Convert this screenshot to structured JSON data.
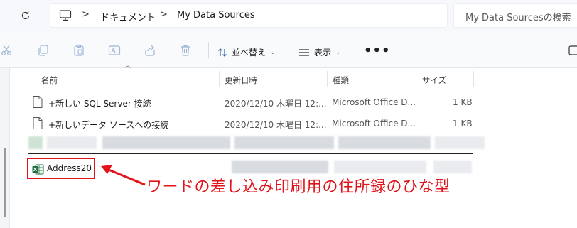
{
  "address_bar": {
    "crumbs": [
      "ドキュメント",
      "My Data Sources"
    ],
    "search_placeholder": "My Data Sourcesの検索"
  },
  "toolbar": {
    "sort_label": "並べ替え",
    "view_label": "表示",
    "more_label": "•••",
    "icons": [
      "cut-icon",
      "copy-icon",
      "paste-icon",
      "rename-icon",
      "share-icon",
      "delete-icon"
    ]
  },
  "columns": {
    "name": "名前",
    "modified": "更新日時",
    "type": "種類",
    "size": "サイズ"
  },
  "files": [
    {
      "name": "+新しい SQL Server 接続",
      "modified": "2020/12/10 木曜日 12:...",
      "type": "Microsoft Office D...",
      "size": "1 KB"
    },
    {
      "name": "+新しいデータ ソースへの接続",
      "modified": "2020/12/10 木曜日 12:...",
      "type": "Microsoft Office D...",
      "size": "1 KB"
    }
  ],
  "highlighted_file": {
    "name": "Address20",
    "icon": "excel-icon"
  },
  "annotation": {
    "text": "ワードの差し込み印刷用の住所録のひな型",
    "color": "#e0141a"
  }
}
